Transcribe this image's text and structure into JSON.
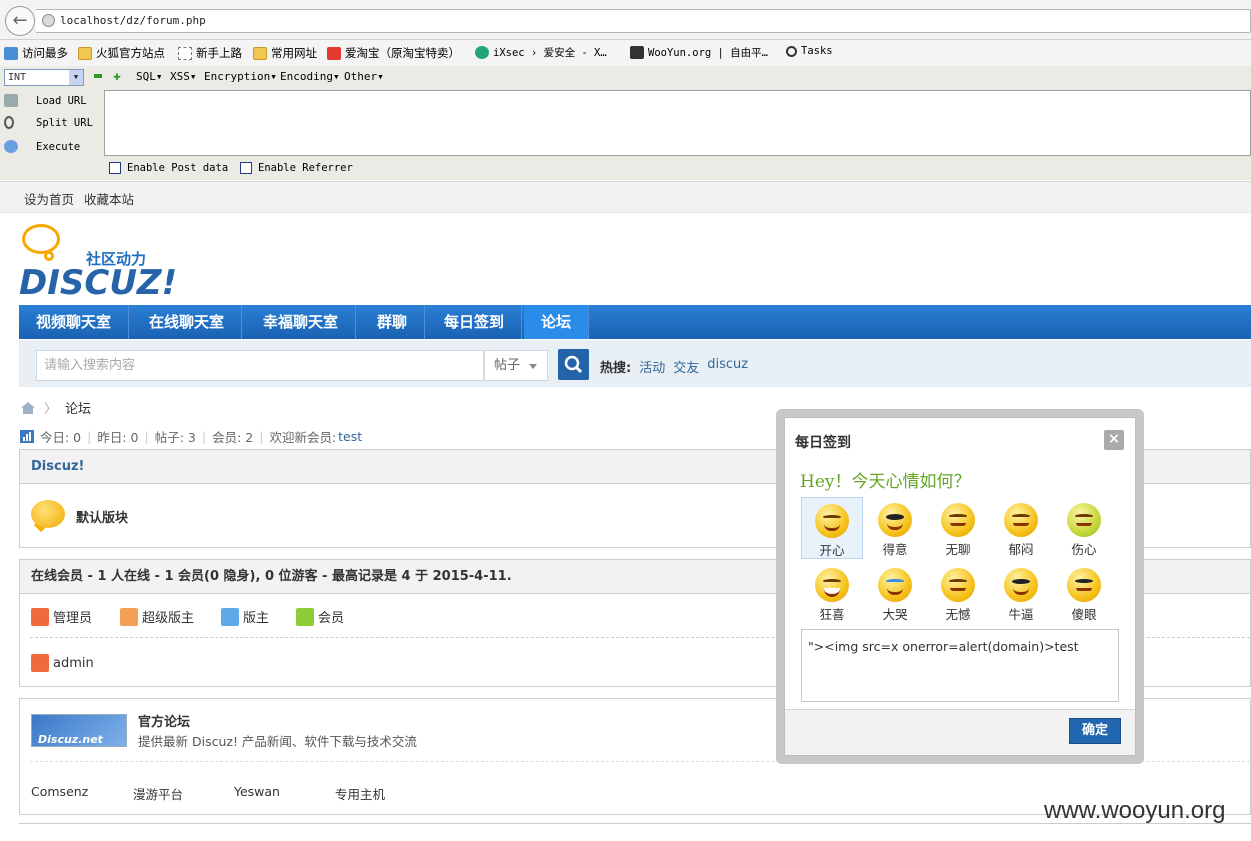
{
  "browser": {
    "url": "localhost/dz/forum.php",
    "bookmarks": [
      "访问最多",
      "火狐官方站点",
      "新手上路",
      "常用网址",
      "爱淘宝（原淘宝特卖）",
      "iXsec › 爱安全 - X…",
      "WooYun.org | 自由平…",
      "Tasks"
    ]
  },
  "hackbar": {
    "select_value": "INT",
    "menus": [
      "SQL▾",
      "XSS▾",
      "Encryption▾",
      "Encoding▾",
      "Other▾"
    ],
    "buttons": [
      "Load URL",
      "Split URL",
      "Execute"
    ],
    "checkboxes": [
      "Enable Post data",
      "Enable Referrer"
    ]
  },
  "site": {
    "top_links": [
      "设为首页",
      "收藏本站"
    ],
    "logo_sub": "社区动力",
    "logo_main": "DISCUZ!",
    "nav": [
      "视频聊天室",
      "在线聊天室",
      "幸福聊天室",
      "群聊",
      "每日签到",
      "论坛"
    ],
    "search_placeholder": "请输入搜索内容",
    "search_type": "帖子",
    "hot_label": "热搜:",
    "hot_links": [
      "活动",
      "交友",
      "discuz"
    ],
    "breadcrumb": "论坛",
    "stats": {
      "today": "今日: 0",
      "yesterday": "昨日: 0",
      "posts": "帖子: 3",
      "members": "会员: 2",
      "welcome": "欢迎新会员:",
      "new_member": "test"
    },
    "category_title": "Discuz!",
    "forum_name": "默认版块",
    "online_title": "在线会员 - 1 人在线 - 1 会员(0 隐身), 0 位游客 - 最高记录是 4 于 2015-4-11.",
    "roles": [
      "管理员",
      "超级版主",
      "版主",
      "会员"
    ],
    "online_user": "admin",
    "official": {
      "logo_text": "Discuz.net",
      "title": "官方论坛",
      "desc": "提供最新 Discuz! 产品新闻、软件下载与技术交流"
    },
    "friend_links": [
      "Comsenz",
      "漫游平台",
      "Yeswan",
      "专用主机"
    ],
    "watermark": "www.wooyun.org"
  },
  "dialog": {
    "title": "每日签到",
    "close": "×",
    "greeting": "Hey！今天心情如何？",
    "moods": [
      "开心",
      "得意",
      "无聊",
      "郁闷",
      "伤心",
      "狂喜",
      "大哭",
      "无憾",
      "牛逼",
      "傻眼"
    ],
    "selected_mood": "开心",
    "text": "\"><img src=x onerror=alert(domain)>test",
    "ok": "确定"
  },
  "colors": {
    "nav": "#1a62b3",
    "accent": "#2366b0",
    "logo": "#f6a800",
    "greeting": "#63a623"
  }
}
